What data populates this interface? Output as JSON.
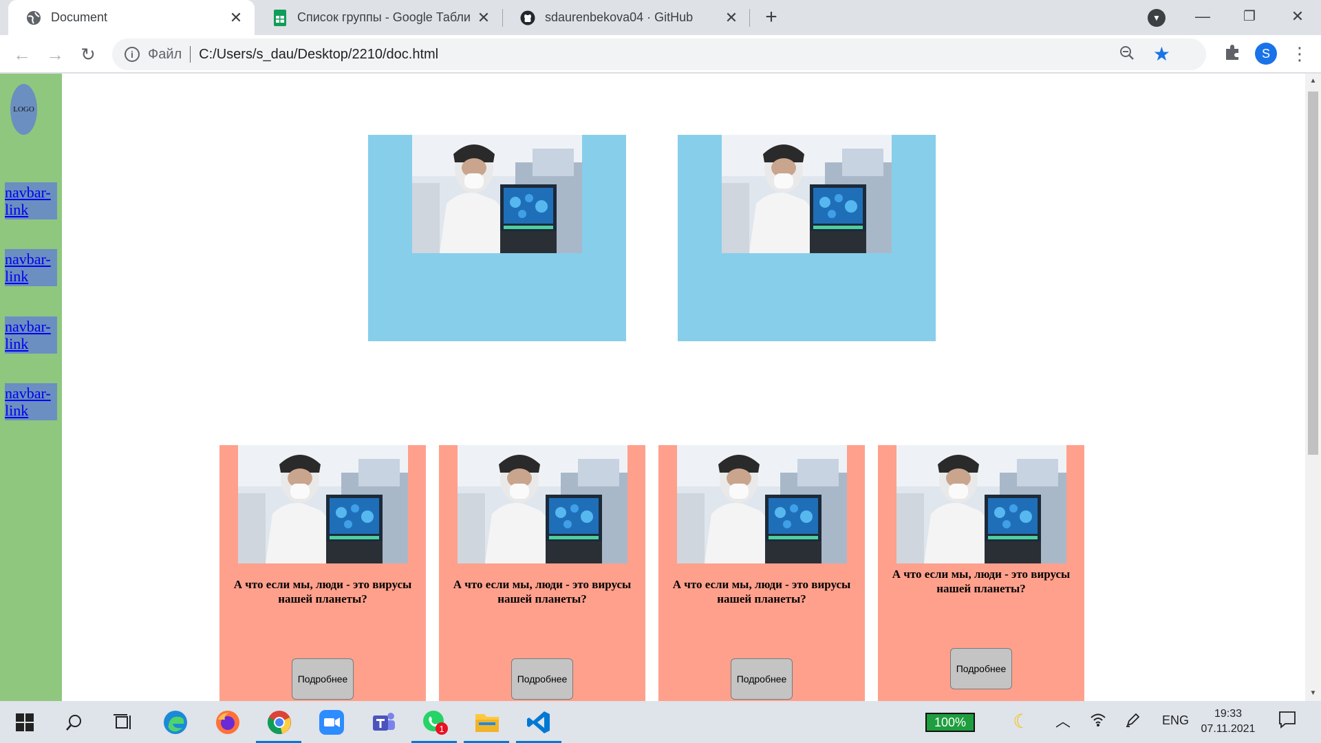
{
  "browser": {
    "tabs": [
      {
        "title": "Document",
        "active": true
      },
      {
        "title": "Список группы - Google Таблиц"
      },
      {
        "title": "sdaurenbekova04 · GitHub"
      }
    ],
    "address": {
      "scheme_label": "Файл",
      "url": "C:/Users/s_dau/Desktop/2210/doc.html"
    },
    "profile_initial": "S"
  },
  "page": {
    "logo": "LOGO",
    "nav_links": [
      "navbar-link",
      "navbar-link",
      "navbar-link",
      "navbar-link"
    ],
    "cards": [
      {
        "text": "А что если мы, люди - это вирусы нашей планеты?",
        "button": "Подробнее"
      },
      {
        "text": "А что если мы, люди - это вирусы нашей планеты?",
        "button": "Подробнее"
      },
      {
        "text": "А что если мы, люди - это вирусы нашей планеты?",
        "button": "Подробнее"
      },
      {
        "text": "А что если мы, люди - это вирусы нашей планеты?",
        "button": "Подробнее"
      }
    ]
  },
  "taskbar": {
    "battery": "100%",
    "language": "ENG",
    "time": "19:33",
    "date": "07.11.2021",
    "whatsapp_badge": "1"
  },
  "colors": {
    "sidebar": "#8fc77f",
    "navlink_bg": "#6a8fc0",
    "hero_card": "#87ceeb",
    "card": "#ffa08c",
    "button": "#c4c4c4"
  }
}
